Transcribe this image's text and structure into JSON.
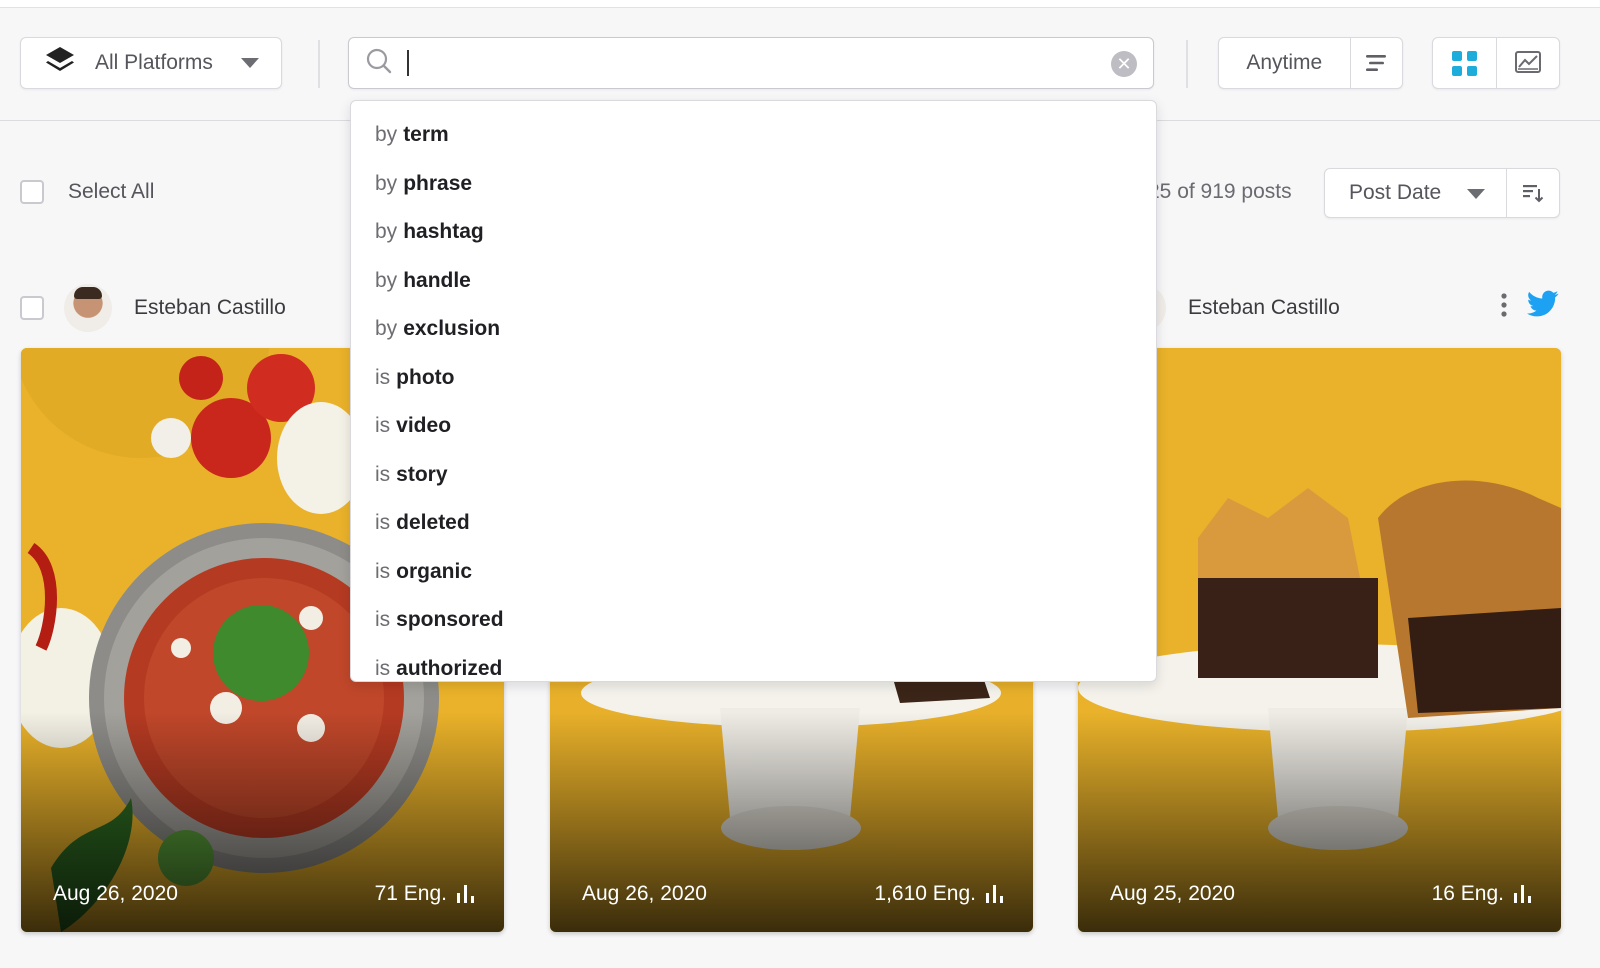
{
  "toolbar": {
    "platform_label": "All Platforms",
    "search_value": "",
    "time_label": "Anytime"
  },
  "list_header": {
    "select_all_label": "Select All",
    "count_text": "25 of 919 posts",
    "sort_label": "Post Date"
  },
  "search_suggestions": [
    {
      "prefix": "by",
      "keyword": "term"
    },
    {
      "prefix": "by",
      "keyword": "phrase"
    },
    {
      "prefix": "by",
      "keyword": "hashtag"
    },
    {
      "prefix": "by",
      "keyword": "handle"
    },
    {
      "prefix": "by",
      "keyword": "exclusion"
    },
    {
      "prefix": "is",
      "keyword": "photo"
    },
    {
      "prefix": "is",
      "keyword": "video"
    },
    {
      "prefix": "is",
      "keyword": "story"
    },
    {
      "prefix": "is",
      "keyword": "deleted"
    },
    {
      "prefix": "is",
      "keyword": "organic"
    },
    {
      "prefix": "is",
      "keyword": "sponsored"
    },
    {
      "prefix": "is",
      "keyword": "authorized"
    }
  ],
  "posts": [
    {
      "author": "Esteban Castillo",
      "date": "Aug 26, 2020",
      "engagement": "71 Eng."
    },
    {
      "author": "",
      "date": "Aug 26, 2020",
      "engagement": "1,610 Eng."
    },
    {
      "author": "Esteban Castillo",
      "date": "Aug 25, 2020",
      "engagement": "16 Eng."
    }
  ],
  "colors": {
    "accent": "#1eaddb",
    "twitter": "#1da1f2",
    "card_background": "#e9b52a"
  },
  "icons": {
    "platform": "layers-icon",
    "search": "search-icon",
    "clear": "clear-circle-icon",
    "filter": "filter-lines-icon",
    "grid_view": "grid-view-icon",
    "chart_view": "chart-view-icon",
    "sort_direction": "sort-descending-icon",
    "more": "more-vertical-icon",
    "network": "twitter-icon",
    "engagement": "bar-chart-icon"
  }
}
